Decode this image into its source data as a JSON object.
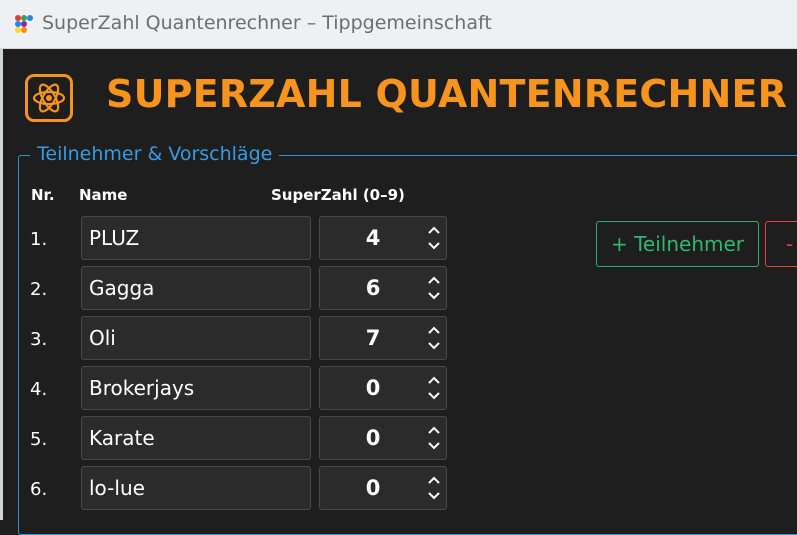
{
  "window": {
    "title": "SuperZahl Quantenrechner – Tippgemeinschaft"
  },
  "header": {
    "title": "SUPERZAHL QUANTENRECHNER",
    "logo_icon": "atom-icon",
    "accent": "#f7941d"
  },
  "group": {
    "title": "Teilnehmer & Vorschläge"
  },
  "columns": {
    "nr": "Nr.",
    "name": "Name",
    "superzahl": "SuperZahl (0–9)"
  },
  "participants": [
    {
      "nr": "1.",
      "name": "PLUZ",
      "superzahl": "4"
    },
    {
      "nr": "2.",
      "name": "Gagga",
      "superzahl": "6"
    },
    {
      "nr": "3.",
      "name": "Oli",
      "superzahl": "7"
    },
    {
      "nr": "4.",
      "name": "Brokerjays",
      "superzahl": "0"
    },
    {
      "nr": "5.",
      "name": "Karate",
      "superzahl": "0"
    },
    {
      "nr": "6.",
      "name": "lo-lue",
      "superzahl": "0"
    }
  ],
  "buttons": {
    "add_participant": "+  Teilnehmer",
    "remove_participant": "-"
  },
  "colors": {
    "group_border": "#2f8fd8",
    "add_green": "#2fb86f",
    "remove_red": "#d9473b"
  }
}
